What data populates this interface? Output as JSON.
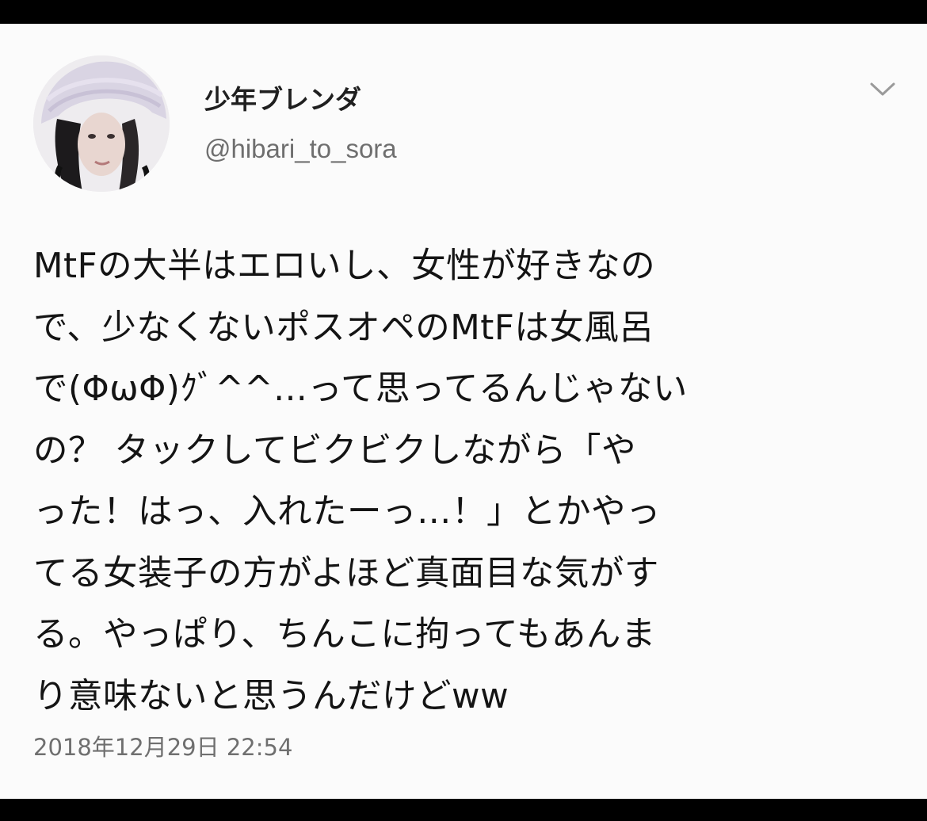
{
  "tweet": {
    "display_name": "少年ブレンダ",
    "handle": "@hibari_to_sora",
    "lines": [
      "MtFの大半はエロいし、女性が好きなの",
      "で、少なくないポスオペのMtFは女風呂",
      "で(ΦωΦ)ｸﾞ^^...って思ってるんじゃない",
      "の？ タックしてビクビクしながら「や",
      "った！はっ、入れたーっ…！」とかやっ",
      "てる女装子の方がよほど真面目な気がす",
      "る。やっぱり、ちんこに拘ってもあんま",
      "り意味ないと思うんだけどww"
    ],
    "timestamp": "2018年12月29日 22:54"
  },
  "icons": {
    "menu": "chevron-down-icon",
    "avatar": "profile-photo"
  },
  "colors": {
    "background": "#fbfbfb",
    "frame": "#000000",
    "text_primary": "#141414",
    "text_secondary": "#6f6f6f",
    "chevron": "#9a9a9a"
  }
}
